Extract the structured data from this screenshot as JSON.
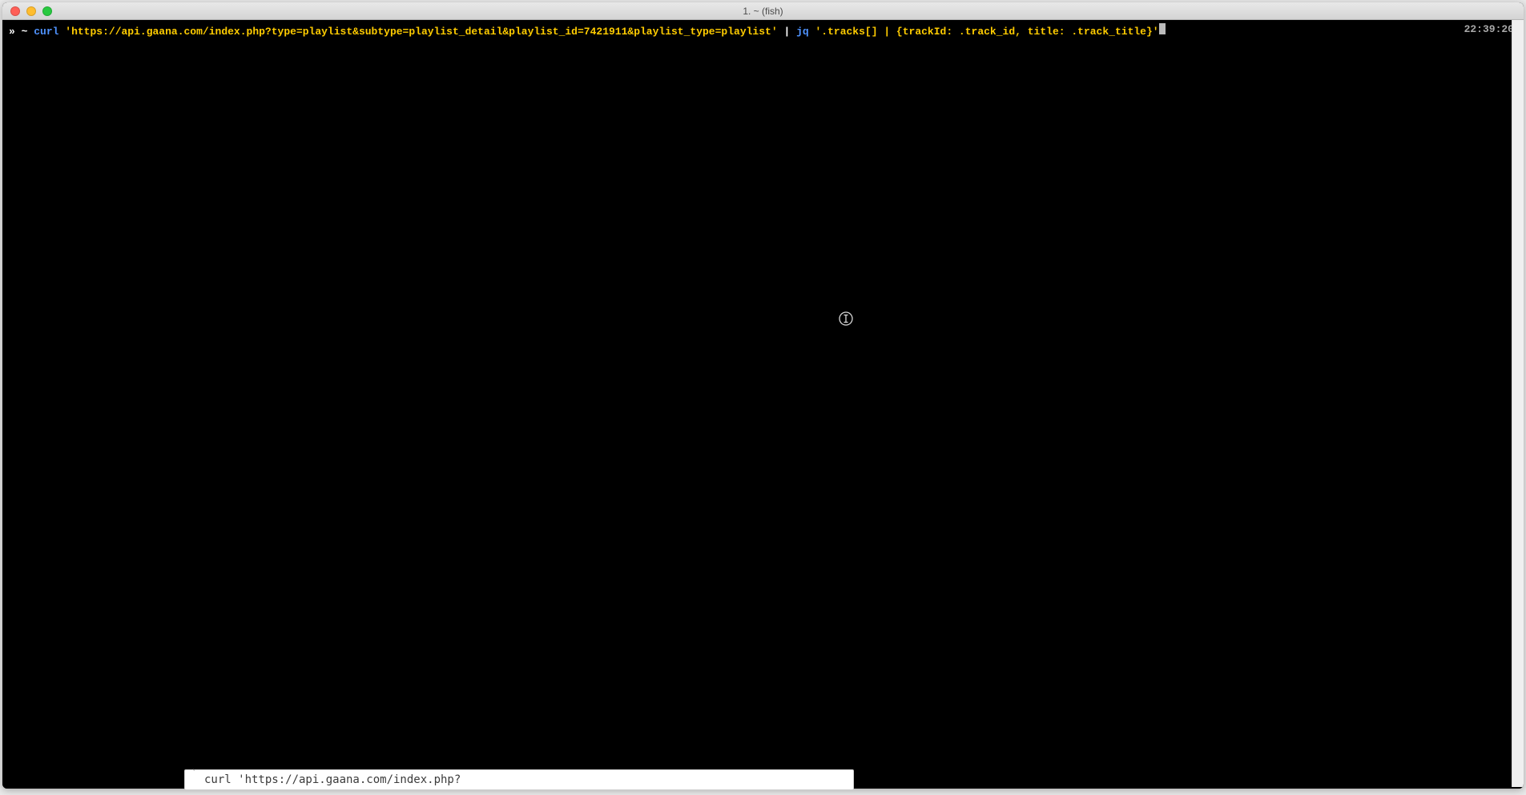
{
  "window": {
    "title": "1. ~ (fish)"
  },
  "prompt": {
    "arrow": "»",
    "cwd": "~",
    "command": {
      "curl_keyword": "curl",
      "url_quoted": "'https://api.gaana.com/index.php?type=playlist&subtype=playlist_detail&playlist_id=7421911&playlist_type=playlist'",
      "pipe": "|",
      "jq_keyword": "jq",
      "jq_arg_quoted": "'.tracks[] | {trackId: .track_id, title: .track_title}'"
    },
    "timestamp": "22:39:20"
  },
  "bottom_snippet": {
    "text": "curl 'https://api.gaana.com/index.php?"
  }
}
